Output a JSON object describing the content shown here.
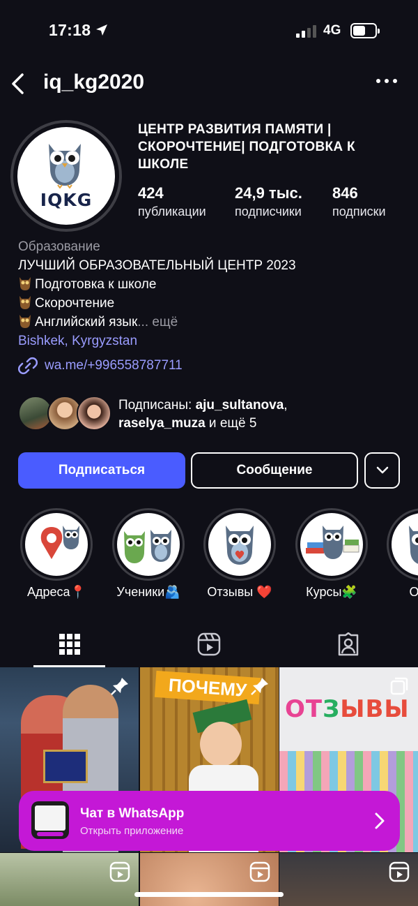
{
  "status": {
    "time": "17:18",
    "network": "4G"
  },
  "nav": {
    "username": "iq_kg2020"
  },
  "profile": {
    "avatar_text": "IQKG",
    "name": "ЦЕНТР РАЗВИТИЯ ПАМЯТИ | СКОРОЧТЕНИЕ| ПОДГОТОВКА К ШКОЛЕ",
    "stats": [
      {
        "num": "424",
        "label": "публикации"
      },
      {
        "num": "24,9 тыс.",
        "label": "подписчики"
      },
      {
        "num": "846",
        "label": "подписки"
      }
    ]
  },
  "bio": {
    "category": "Образование",
    "line1": "ЛУЧШИЙ ОБРАЗОВАТЕЛЬНЫЙ ЦЕНТР 2023",
    "line2": "Подготовка к школе",
    "line3": "Скорочтение",
    "line4": "Английский язык",
    "more": "... ещё",
    "location": "Bishkek, Kyrgyzstan",
    "link": "wa.me/+996558787711"
  },
  "followed_by": {
    "prefix": "Подписаны: ",
    "user1": "aju_sultanova",
    "comma": ",",
    "user2": "raselya_muza",
    "suffix": " и ещё 5"
  },
  "buttons": {
    "follow": "Подписаться",
    "message": "Сообщение"
  },
  "highlights": [
    {
      "label": "Адреса📍"
    },
    {
      "label": "Ученики🫂"
    },
    {
      "label": "Отзывы ❤️"
    },
    {
      "label": "Курсы🧩"
    },
    {
      "label": "О на"
    }
  ],
  "posts": {
    "post2_overlay": "ПОЧЕМУ",
    "post3_overlay_a": "ОТ",
    "post3_overlay_b": "З",
    "post3_overlay_c": "ЫВЫ"
  },
  "whatsapp_banner": {
    "title": "Чат в WhatsApp",
    "subtitle": "Открыть приложение"
  },
  "colors": {
    "accent": "#4a5cff",
    "link": "#9a9cff",
    "banner": "#c418d6",
    "background": "#0f0f17"
  }
}
